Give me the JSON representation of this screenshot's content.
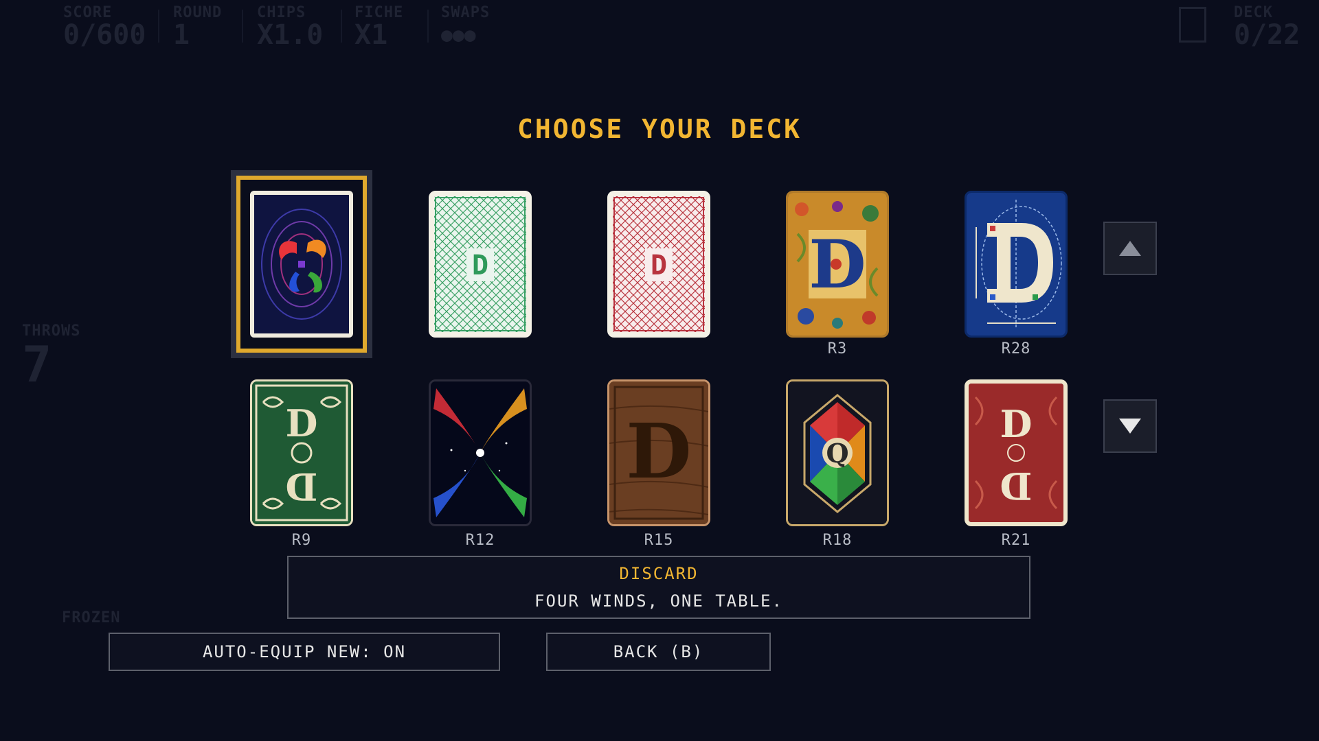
{
  "hud": {
    "score_label": "SCORE",
    "score_value": "0/600",
    "round_label": "ROUND",
    "round_value": "1",
    "chips_label": "CHIPS",
    "chips_value": "X1.0",
    "fiche_label": "FICHE",
    "fiche_value": "X1",
    "swaps_label": "SWAPS",
    "swaps_value": "●●●",
    "deck_label": "DECK",
    "deck_value": "0/22",
    "throws_label": "THROWS",
    "throws_value": "7",
    "frozen_label": "FROZEN"
  },
  "title": "CHOOSE YOUR DECK",
  "decks": [
    {
      "id": "swirl",
      "label": "",
      "selected": true
    },
    {
      "id": "green-d",
      "label": ""
    },
    {
      "id": "red-d",
      "label": ""
    },
    {
      "id": "illuminated-d",
      "label": "R3"
    },
    {
      "id": "blueprint-d",
      "label": "R28"
    },
    {
      "id": "green-ornate",
      "label": "R9"
    },
    {
      "id": "nebula",
      "label": "R12"
    },
    {
      "id": "wood-d",
      "label": "R15"
    },
    {
      "id": "stained-glass",
      "label": "R18"
    },
    {
      "id": "red-ornate",
      "label": "R21"
    }
  ],
  "tooltip": {
    "title": "DISCARD",
    "text": "FOUR WINDS, ONE TABLE."
  },
  "buttons": {
    "auto_equip": "AUTO-EQUIP NEW: ON",
    "back": "BACK (B)"
  },
  "colors": {
    "accent": "#f2b632",
    "background": "#0a0d1c",
    "selected_frame": "#e0a92d"
  }
}
